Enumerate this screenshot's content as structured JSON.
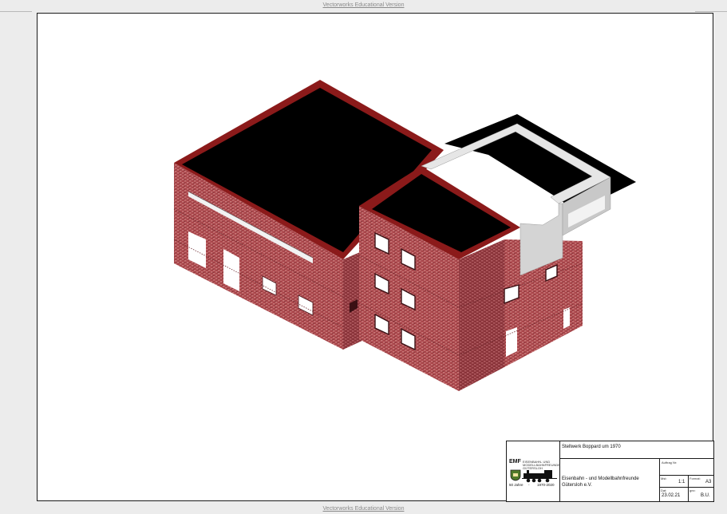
{
  "watermark": {
    "top": "Vectorworks Educational Version",
    "bottom": "Vectorworks Educational Version"
  },
  "titleblock": {
    "project_title": "Stellwerk Boppard um 1970",
    "logo": {
      "brand": "EMF",
      "org_lines": [
        "EISENBAHN- UND",
        "MODELLBAHNFREUNDE",
        "GÜTERSLOH"
      ],
      "anniversary": "50 Jahre",
      "years": "1970-2020"
    },
    "org_name_line1": "Eisenbahn - und Modellbahnfreunde",
    "org_name_line2": "Gütersloh e.V.",
    "auftrag_label": "Auftrag Nr:",
    "auftrag_value": "",
    "mst_label": "Mst:",
    "mst_value": "1:1",
    "format_label": "Format:",
    "format_value": "A3",
    "dat_label": "Dat:",
    "dat_value": "23.02.21",
    "gez_label": "gez:",
    "gez_value": "B.U."
  },
  "colors": {
    "brick": "#a8454a",
    "brick_dark": "#7a2a30",
    "roof": "#000000",
    "parapet": "#8b1a1a",
    "concrete": "#d9d9d9",
    "window": "#ffffff"
  }
}
